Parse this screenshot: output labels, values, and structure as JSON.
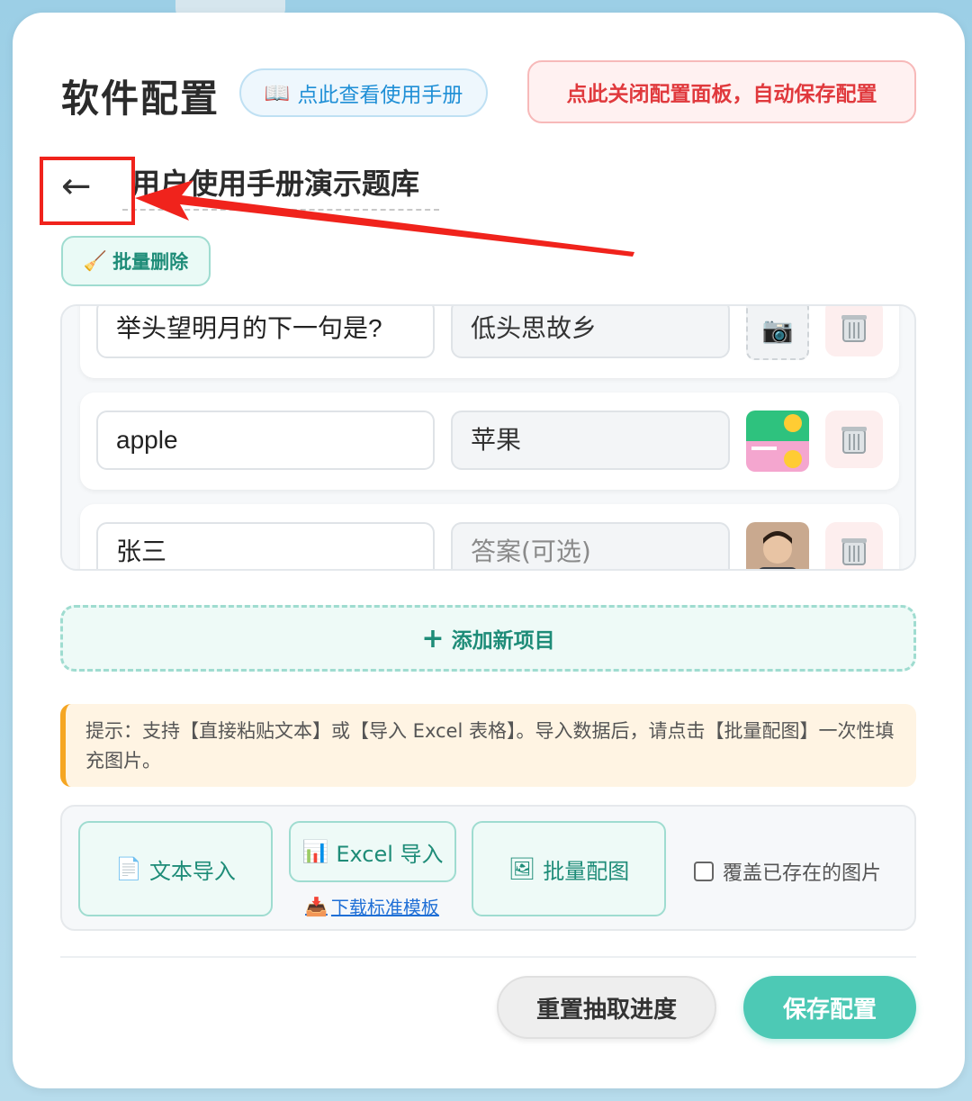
{
  "header": {
    "title": "软件配置",
    "manual_icon": "📖",
    "manual_label": "点此查看使用手册",
    "close_label": "点此关闭配置面板，自动保存配置"
  },
  "editor": {
    "back_icon": "←",
    "quiz_title": "用户使用手册演示题库",
    "batch_delete_icon": "🧹",
    "batch_delete_label": "批量删除"
  },
  "items": [
    {
      "question": "举头望明月的下一句是?",
      "answer": "低头思故乡",
      "image": "camera-icon"
    },
    {
      "question": "apple",
      "answer": "苹果",
      "image": "meme-thumbnail"
    },
    {
      "question": "张三",
      "answer_placeholder": "答案(可选)",
      "image": "avatar-thumbnail"
    }
  ],
  "add_button": {
    "icon": "+",
    "label": "添加新项目"
  },
  "tip": {
    "text": "提示：支持【直接粘贴文本】或【导入 Excel 表格】。导入数据后，请点击【批量配图】一次性填充图片。"
  },
  "import": {
    "text_import_icon": "📄",
    "text_import_label": "文本导入",
    "excel_import_icon": "📊",
    "excel_import_label": "Excel 导入",
    "download_icon": "📥",
    "download_label": "下载标准模板",
    "batch_image_icon": "🖼",
    "batch_image_label": "批量配图",
    "overwrite_label": "覆盖已存在的图片",
    "overwrite_checked": false
  },
  "footer": {
    "reset_label": "重置抽取进度",
    "save_label": "保存配置"
  },
  "colors": {
    "accent": "#4dc9b5",
    "danger": "#e0393d",
    "link": "#1f8fd6",
    "highlight": "#f0231c"
  }
}
